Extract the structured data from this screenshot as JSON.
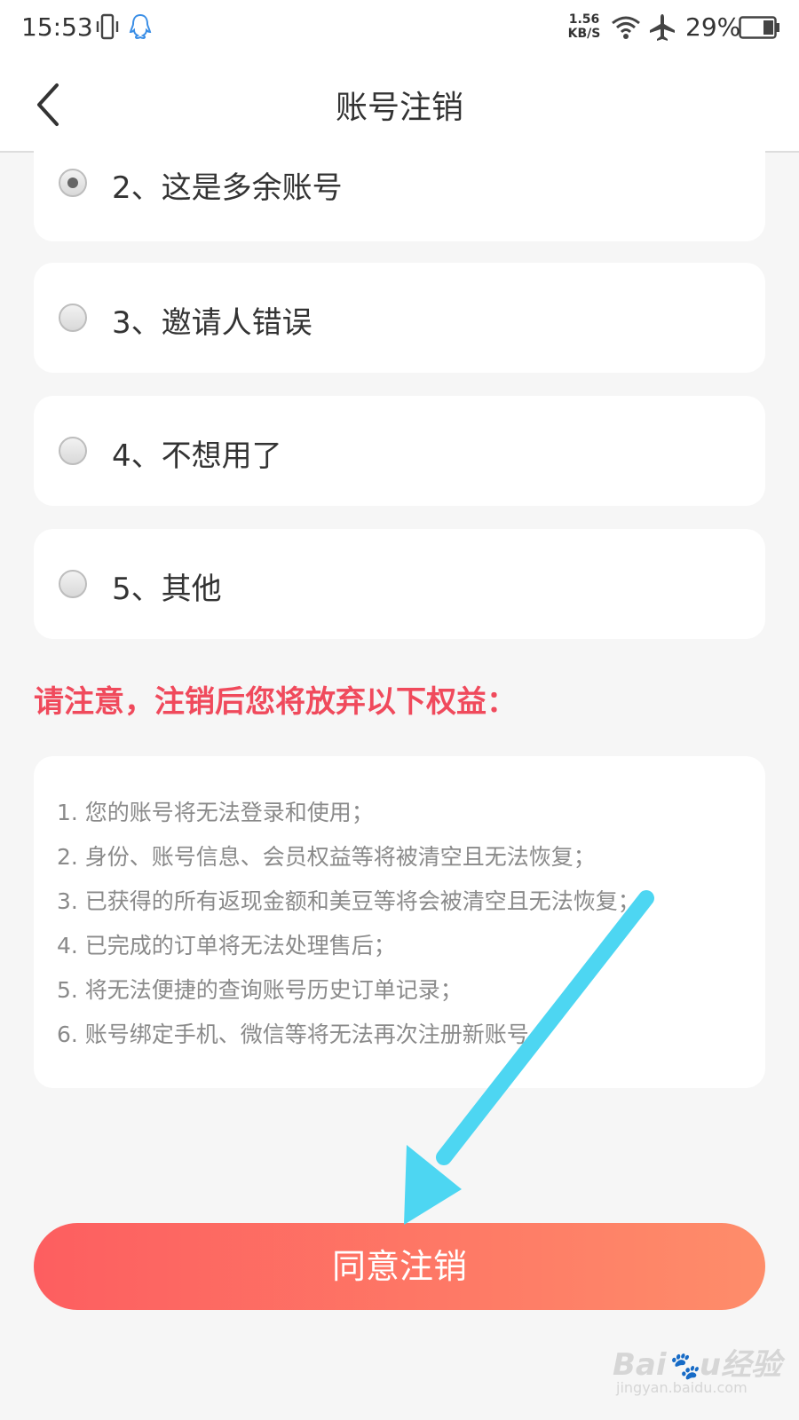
{
  "status_bar": {
    "time": "15:53",
    "net_speed_value": "1.56",
    "net_speed_unit": "KB/S",
    "battery": "29%",
    "icons": [
      "vibrate-icon",
      "qq-icon",
      "wifi-icon",
      "airplane-icon",
      "battery-icon"
    ]
  },
  "header": {
    "title": "账号注销",
    "back_icon": "chevron-left-icon"
  },
  "options": [
    {
      "label": "2、这是多余账号",
      "selected": true
    },
    {
      "label": "3、邀请人错误",
      "selected": false
    },
    {
      "label": "4、不想用了",
      "selected": false
    },
    {
      "label": "5、其他",
      "selected": false
    }
  ],
  "notice": {
    "title": "请注意，注销后您将放弃以下权益：",
    "color": "#f04a5c",
    "items": [
      "1. 您的账号将无法登录和使用；",
      "2. 身份、账号信息、会员权益等将被清空且无法恢复；",
      "3. 已获得的所有返现金额和美豆等将会被清空且无法恢复；",
      "4. 已完成的订单将无法处理售后；",
      "5. 将无法便捷的查询账号历史订单记录；",
      "6. 账号绑定手机、微信等将无法再次注册新账号。"
    ]
  },
  "actions": {
    "agree_label": "同意注销",
    "gradient_start": "#fd5e60",
    "gradient_end": "#fe8d6a"
  },
  "annotation": {
    "arrow_color": "#4dd6f2"
  },
  "watermark": {
    "logo": "Baidu经验",
    "url": "jingyan.baidu.com"
  }
}
